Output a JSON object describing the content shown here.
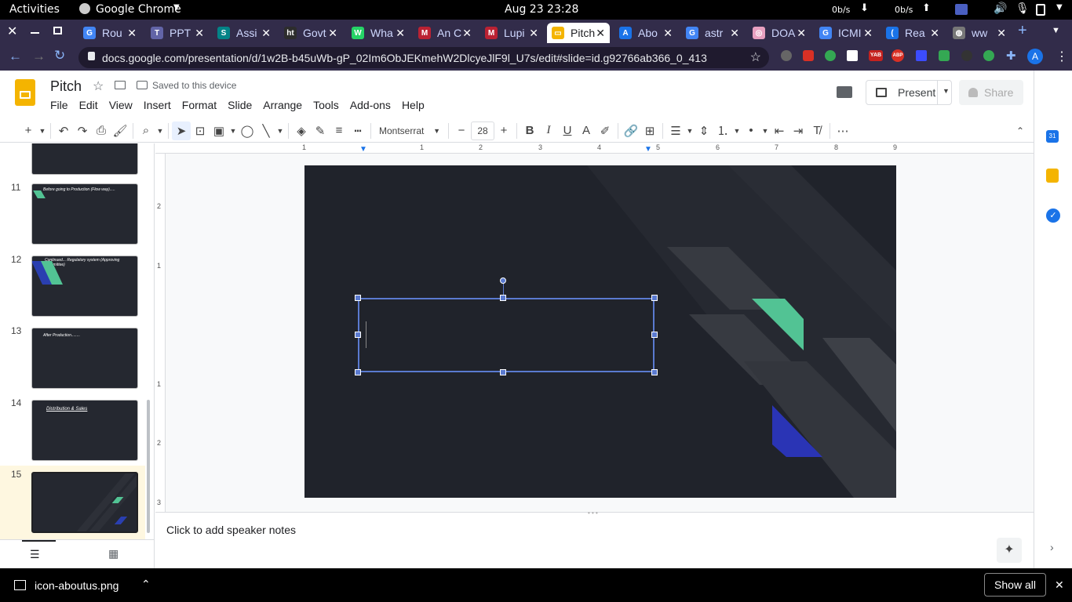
{
  "system": {
    "activities": "Activities",
    "app_name": "Google Chrome",
    "datetime": "Aug 23  23:28",
    "net_down": "0b/s",
    "net_up": "0b/s"
  },
  "tabs": [
    {
      "label": "Rou",
      "color": "#4285f4",
      "glyph": "G"
    },
    {
      "label": "PPT",
      "color": "#6264a7",
      "glyph": "T"
    },
    {
      "label": "Assi",
      "color": "#038387",
      "glyph": "S"
    },
    {
      "label": "Govt",
      "color": "#2d2d2d",
      "glyph": "ht"
    },
    {
      "label": "Wha",
      "color": "#25d366",
      "glyph": "W"
    },
    {
      "label": "An C",
      "color": "#b23",
      "glyph": "M"
    },
    {
      "label": "Lupi",
      "color": "#b23",
      "glyph": "M"
    },
    {
      "label": "Pitch",
      "color": "#f4b400",
      "glyph": "▭"
    },
    {
      "label": "Abo",
      "color": "#1a73e8",
      "glyph": "A"
    },
    {
      "label": "astr",
      "color": "#4285f4",
      "glyph": "G"
    },
    {
      "label": "DOA",
      "color": "#e8a0c0",
      "glyph": "◎"
    },
    {
      "label": "ICMI",
      "color": "#4285f4",
      "glyph": "G"
    },
    {
      "label": "Rea",
      "color": "#1a73e8",
      "glyph": "("
    },
    {
      "label": "ww",
      "color": "#777",
      "glyph": "◍"
    }
  ],
  "address": {
    "url": "docs.google.com/presentation/d/1w2B-b45uWb-gP_02Im6ObJEKmehW2DlcyeJlF9l_U7s/edit#slide=id.g92766ab366_0_413"
  },
  "extensions": [
    "YAB",
    "ABP"
  ],
  "doc": {
    "title": "Pitch",
    "save_status": "Saved to this device",
    "present_label": "Present",
    "share_label": "Share",
    "avatar": "A"
  },
  "menu": [
    "File",
    "Edit",
    "View",
    "Insert",
    "Format",
    "Slide",
    "Arrange",
    "Tools",
    "Add-ons",
    "Help"
  ],
  "toolbar": {
    "font": "Montserrat",
    "font_size": "28"
  },
  "ruler": {
    "h": [
      "1",
      "1",
      "2",
      "3",
      "4",
      "5",
      "6",
      "7",
      "8",
      "9"
    ],
    "v": [
      "2",
      "1",
      "1",
      "2",
      "3"
    ]
  },
  "slides": [
    {
      "num": "11",
      "title": "Before going to Production (Flow way)....."
    },
    {
      "num": "12",
      "title": "Continued... Regulatory system (Approving Committee)"
    },
    {
      "num": "13",
      "title": "After Production........"
    },
    {
      "num": "14",
      "title": "Distribution & Sales"
    },
    {
      "num": "15",
      "title": ""
    }
  ],
  "notes": {
    "placeholder": "Click to add speaker notes"
  },
  "download": {
    "filename": "icon-aboutus.png",
    "show_all": "Show all"
  }
}
